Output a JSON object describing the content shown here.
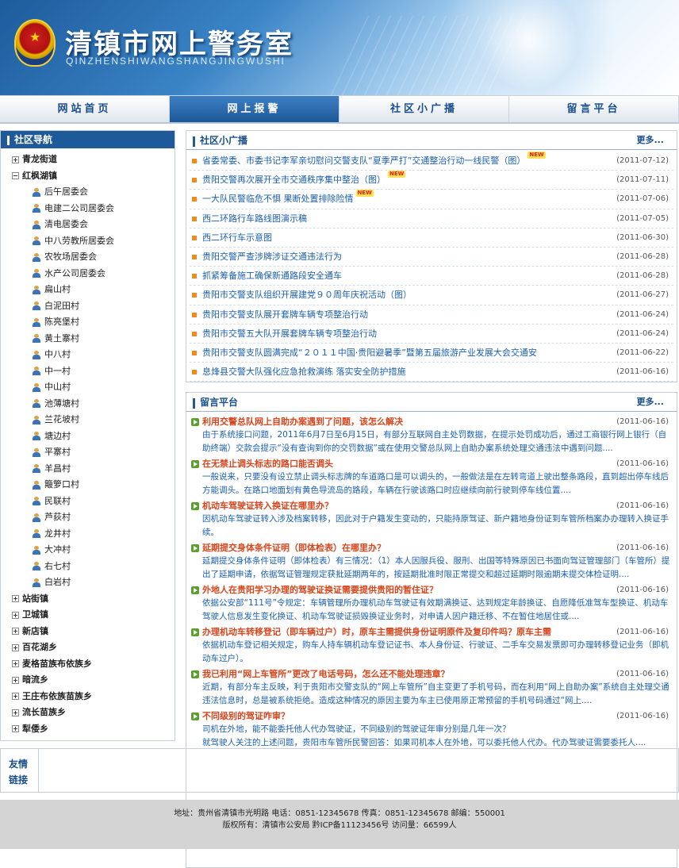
{
  "header": {
    "title": "清镇市网上警务室",
    "subtitle": "QINZHENSHIWANGSHANGJINGWUSHI"
  },
  "nav": [
    "网站首页",
    "网上报警",
    "社区小广播",
    "留言平台"
  ],
  "sidebar": {
    "title": "社区导航",
    "groups": [
      {
        "label": "青龙街道",
        "expanded": false,
        "children": []
      },
      {
        "label": "红枫湖镇",
        "expanded": true,
        "children": [
          "后午居委会",
          "电建二公司居委会",
          "清电居委会",
          "中八劳教所居委会",
          "农牧场居委会",
          "水产公司居委会",
          "扁山村",
          "白泥田村",
          "陈亮堡村",
          "黄土寨村",
          "中八村",
          "中一村",
          "中山村",
          "池薄塘村",
          "兰花坡村",
          "塘边村",
          "平寨村",
          "羊昌村",
          "簸箩口村",
          "民联村",
          "芦荻村",
          "龙井村",
          "大冲村",
          "右七村",
          "白岩村"
        ]
      },
      {
        "label": "站街镇",
        "expanded": false,
        "children": []
      },
      {
        "label": "卫城镇",
        "expanded": false,
        "children": []
      },
      {
        "label": "新店镇",
        "expanded": false,
        "children": []
      },
      {
        "label": "百花湖乡",
        "expanded": false,
        "children": []
      },
      {
        "label": "麦格苗族布依族乡",
        "expanded": false,
        "children": []
      },
      {
        "label": "暗流乡",
        "expanded": false,
        "children": []
      },
      {
        "label": "王庄布依族苗族乡",
        "expanded": false,
        "children": []
      },
      {
        "label": "流长苗族乡",
        "expanded": false,
        "children": []
      },
      {
        "label": "犁倭乡",
        "expanded": false,
        "children": []
      }
    ]
  },
  "broadcast": {
    "title": "社区小广播",
    "more": "更多...",
    "new_badge": "NEW",
    "items": [
      {
        "text": "省委常委、市委书记李军亲切慰问交警支队“夏季严打”交通整治行动一线民警（图）",
        "date": "(2011-07-12)",
        "isNew": true
      },
      {
        "text": "贵阳交警再次展开全市交通秩序集中整治（图）",
        "date": "(2011-07-11)",
        "isNew": true
      },
      {
        "text": "一大队民警临危不惧  果断处置排除险情",
        "date": "(2011-07-06)",
        "isNew": true
      },
      {
        "text": "西二环路行车路线图演示稿",
        "date": "(2011-07-05)",
        "isNew": false
      },
      {
        "text": "西二环行车示意图",
        "date": "(2011-06-30)",
        "isNew": false
      },
      {
        "text": "贵阳交警严查涉牌涉证交通违法行为",
        "date": "(2011-06-28)",
        "isNew": false
      },
      {
        "text": "抓紧筹备施工确保新通路段安全通车",
        "date": "(2011-06-28)",
        "isNew": false
      },
      {
        "text": "贵阳市交警支队组织开展建党９０周年庆祝活动（图）",
        "date": "(2011-06-27)",
        "isNew": false
      },
      {
        "text": "贵阳市交警支队展开套牌车辆专项整治行动",
        "date": "(2011-06-24)",
        "isNew": false
      },
      {
        "text": "贵阳市交警五大队开展套牌车辆专项整治行动",
        "date": "(2011-06-24)",
        "isNew": false
      },
      {
        "text": "贵阳市交警支队圆满完成“２０１１中国·贵阳避暑季”暨第五届旅游产业发展大会交通安",
        "date": "(2011-06-22)",
        "isNew": false
      },
      {
        "text": "息烽县交警大队强化应急抢救演练     落实安全防护措施",
        "date": "(2011-06-16)",
        "isNew": false
      }
    ]
  },
  "messages": {
    "title": "留言平台",
    "more": "更多...",
    "items": [
      {
        "title": "利用交警总队网上自助办案遇到了问题，该怎么解决",
        "date": "(2011-06-16)",
        "body": "由于系统接口问题，2011年6月7日至6月15日，有部分互联网自主处罚数据，在提示处罚成功后，通过工商银行网上银行（自助终端）交款会提示“没有查询到你的交罚数据”或在使用交警总队网上自助办案系统处理交通违法中遇到问题...."
      },
      {
        "title": "在无禁止调头标志的路口能否调头",
        "date": "(2011-06-16)",
        "body": "一般说来，只要没有设立禁止调头标志牌的车道路口是可以调头的，一般做法是在左转弯道上驶出整条路段，直到超出停车线后方能调头。在路口地面划有黄色导流岛的路段，车辆在行驶该路口时应继续向前行驶到停车线位置...."
      },
      {
        "title": "机动车驾驶证转入换证在哪里办？",
        "date": "(2011-06-16)",
        "body": "因机动车驾驶证转入涉及档案转移，因此对于户籍发生变动的，只能持原驾证、新户籍地身份证到车管所档案办办理转入换证手续。"
      },
      {
        "title": "延期提交身体条件证明（即体检表）在哪里办？",
        "date": "(2011-06-16)",
        "body": "延期提交身体条件证明（即体检表）有三情况：（1）本人因服兵役、服刑、出国等特殊原因已书面向驾证管理部门（车管所）提出了延期申请，依据驾证管理规定获批延期两年的，按延期批准时限正常提交和超过延期时限逾期未提交体检证明...."
      },
      {
        "title": "外地人在贵阳学习办理的驾驶证换证需要提供贵阳的暂住证？",
        "date": "(2011-06-16)",
        "body": "依据公安部“111号”令规定：车辆管理所办理机动车驾驶证有效期满换证、达到规定年龄换证、自愿降低准驾车型换证、机动车驾驶人信息发生变化换证、机动车驾驶证损毁换证业务时，对申请人因户籍迁移、不在暂住地居住或...."
      },
      {
        "title": "办理机动车转移登记（即车辆过户）时，原车主需提供身份证明原件及复印件吗？原车主需",
        "date": "(2011-06-16)",
        "body": "依据机动车登记相关规定，购车人持车辆机动车登记证书、本人身份证、行驶证、二手车交易发票即可办理转移登记业务（即机动车过户）。"
      },
      {
        "title": "我已利用“网上车管所”更改了电话号码，怎么还不能处理违章？",
        "date": "(2011-06-16)",
        "body": "近期，有部分车主反映，利于贵阳市交警支队的“网上车管所”自主变更了手机号码，而在利用“网上自助办案”系统自主处理交通违法信息时，总是被系统拒绝。造成这种情况的原因主要为车主已使用原正常预留的手机号码通过“网上...."
      },
      {
        "title": "不同级别的驾证咋审？",
        "date": "(2011-06-16)",
        "body": "司机在外地，能不能委托他人代办驾驶证，不同级别的驾驶证年审分别是几年一次？\n就驾驶人关注的上述问题，贵阳市车管所民警回答：如果司机本人在外地，可以委托他人代办。代办驾驶证需要委托人...."
      }
    ]
  },
  "links": {
    "label_line1": "友情",
    "label_line2": "链接"
  },
  "footer": {
    "line1": "地址：贵州省清镇市光明路  电话：0851-12345678  传真：0851-12345678  邮编：550001",
    "line2": "版权所有：清镇市公安局  黔ICP备11123456号  访问量：66599人"
  }
}
